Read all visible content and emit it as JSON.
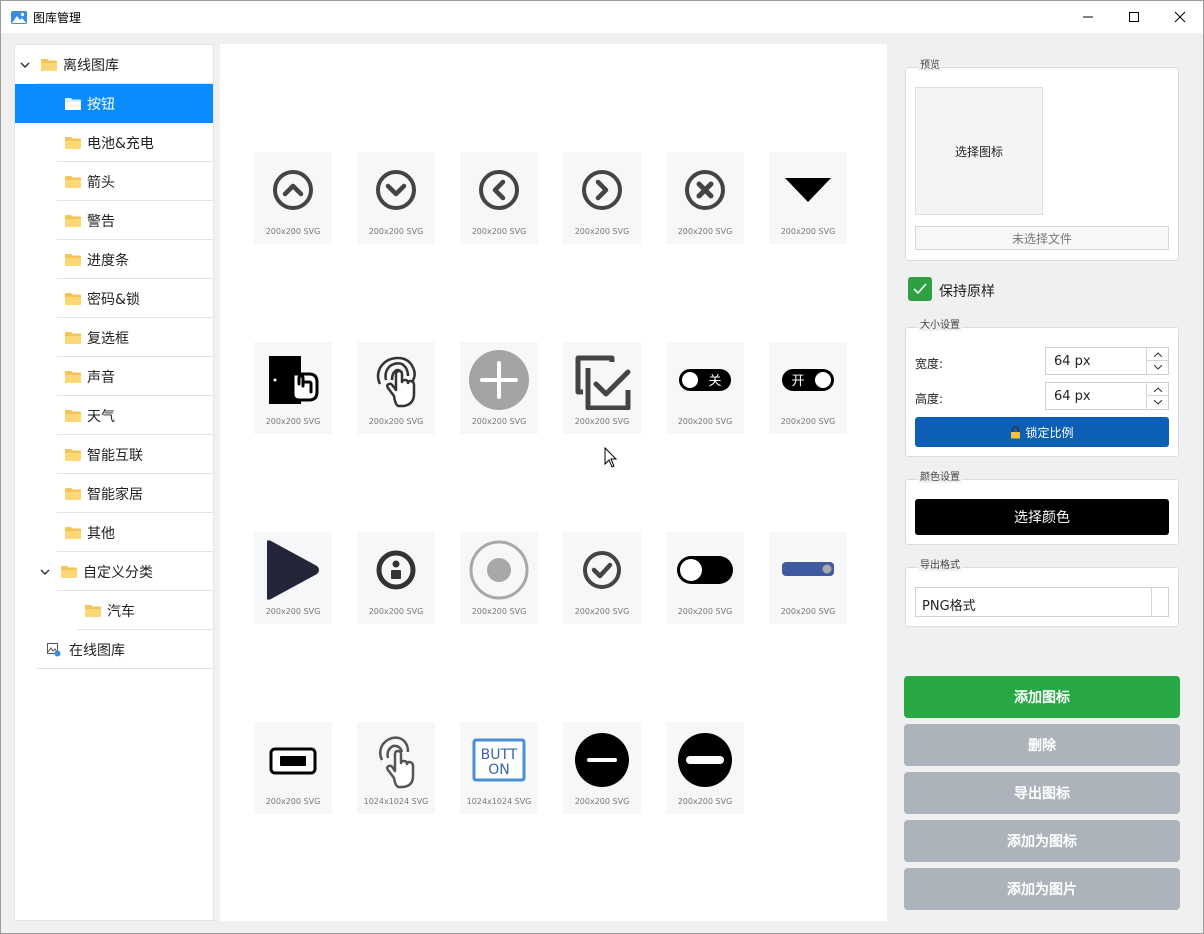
{
  "window": {
    "title": "图库管理"
  },
  "tree": {
    "items": [
      {
        "label": "离线图库",
        "level": 0,
        "expanded": true
      },
      {
        "label": "按钮",
        "level": 1,
        "selected": true
      },
      {
        "label": "电池&充电",
        "level": 1
      },
      {
        "label": "箭头",
        "level": 1
      },
      {
        "label": "警告",
        "level": 1
      },
      {
        "label": "进度条",
        "level": 1
      },
      {
        "label": "密码&锁",
        "level": 1
      },
      {
        "label": "复选框",
        "level": 1
      },
      {
        "label": "声音",
        "level": 1
      },
      {
        "label": "天气",
        "level": 1
      },
      {
        "label": "智能互联",
        "level": 1
      },
      {
        "label": "智能家居",
        "level": 1
      },
      {
        "label": "其他",
        "level": 1
      },
      {
        "label": "自定义分类",
        "level": 1,
        "expanded": true
      },
      {
        "label": "汽车",
        "level": 2
      },
      {
        "label": "在线图库",
        "level": 0
      }
    ]
  },
  "icons": [
    {
      "icon": "circle-chevron-up-icon",
      "caption": "200x200 SVG"
    },
    {
      "icon": "circle-chevron-down-icon",
      "caption": "200x200 SVG"
    },
    {
      "icon": "circle-chevron-left-icon",
      "caption": "200x200 SVG"
    },
    {
      "icon": "circle-chevron-right-icon",
      "caption": "200x200 SVG"
    },
    {
      "icon": "circle-close-icon",
      "caption": "200x200 SVG"
    },
    {
      "icon": "triangle-down-icon",
      "caption": "200x200 SVG"
    },
    {
      "icon": "door-touch-icon",
      "caption": "200x200 SVG"
    },
    {
      "icon": "fingerprint-touch-icon",
      "caption": "200x200 SVG"
    },
    {
      "icon": "plus-circle-icon",
      "caption": "200x200 SVG"
    },
    {
      "icon": "copy-check-icon",
      "caption": "200x200 SVG"
    },
    {
      "icon": "toggle-off-icon",
      "caption": "200x200 SVG",
      "text": "关"
    },
    {
      "icon": "toggle-on-icon",
      "caption": "200x200 SVG",
      "text": "开"
    },
    {
      "icon": "play-icon",
      "caption": "200x200 SVG"
    },
    {
      "icon": "info-circle-icon",
      "caption": "200x200 SVG"
    },
    {
      "icon": "radio-button-icon",
      "caption": "200x200 SVG"
    },
    {
      "icon": "check-circle-icon",
      "caption": "200x200 SVG"
    },
    {
      "icon": "toggle-switch-icon",
      "caption": "200x200 SVG"
    },
    {
      "icon": "slider-bar-icon",
      "caption": "200x200 SVG"
    },
    {
      "icon": "rect-button-icon",
      "caption": "200x200 SVG"
    },
    {
      "icon": "touch-hand-icon",
      "caption": "1024x1024 SVG"
    },
    {
      "icon": "text-button-icon",
      "caption": "1024x1024 SVG",
      "text_line1": "BUTT",
      "text_line2": "ON"
    },
    {
      "icon": "minus-circle-icon",
      "caption": "200x200 SVG"
    },
    {
      "icon": "minus-circle-bold-icon",
      "caption": "200x200 SVG"
    }
  ],
  "preview": {
    "title": "预览",
    "placeholder": "选择图标",
    "file_label": "未选择文件"
  },
  "keep_original": {
    "label": "保持原样",
    "checked": true
  },
  "size": {
    "title": "大小设置",
    "width_label": "宽度:",
    "width_value": "64 px",
    "height_label": "高度:",
    "height_value": "64 px",
    "lock_label": "锁定比例"
  },
  "color": {
    "title": "颜色设置",
    "button_label": "选择颜色",
    "value": "#000000"
  },
  "export": {
    "title": "导出格式",
    "selected": "PNG格式"
  },
  "actions": {
    "add_icon": "添加图标",
    "delete": "删除",
    "export_icon": "导出图标",
    "add_as_icon": "添加为图标",
    "add_as_image": "添加为图片"
  },
  "colors": {
    "accent": "#0a8cff",
    "success": "#28a745",
    "disabled": "#adb3bb",
    "lock": "#0d5fb5"
  }
}
